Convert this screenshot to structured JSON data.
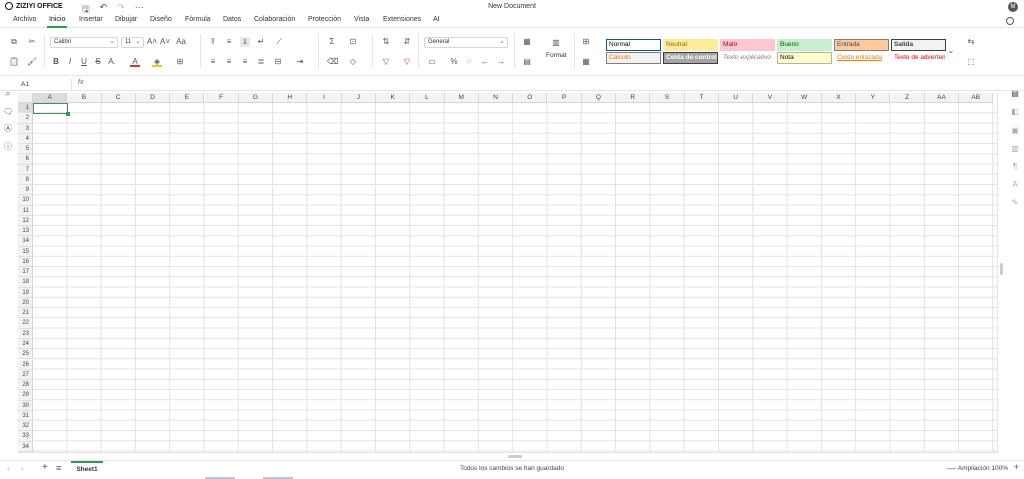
{
  "app": {
    "brand": "ZIZIYI OFFICE",
    "document_title": "New Document",
    "user_initial": "M"
  },
  "menu": {
    "items": [
      "Archivo",
      "Inicio",
      "Insertar",
      "Dibujar",
      "Diseño",
      "Fórmula",
      "Datos",
      "Colaboración",
      "Protección",
      "Vista",
      "Extensiones",
      "AI"
    ],
    "active": "Inicio"
  },
  "ribbon": {
    "font_name": "Calibri",
    "font_size": "11",
    "number_format": "General",
    "format_label": "Format",
    "cell_styles": [
      {
        "label": "Normal",
        "bg": "#ffffff",
        "fg": "#000000",
        "border": "#1f4e79"
      },
      {
        "label": "Neutral",
        "bg": "#ffeb9c",
        "fg": "#9c6500",
        "border": "#ffeb9c"
      },
      {
        "label": "Malo",
        "bg": "#ffc7ce",
        "fg": "#9c0006",
        "border": "#ffc7ce"
      },
      {
        "label": "Bueno",
        "bg": "#c6efce",
        "fg": "#006100",
        "border": "#c6efce"
      },
      {
        "label": "Entrada",
        "bg": "#ffcc99",
        "fg": "#3f3f76",
        "border": "#7f7f7f"
      },
      {
        "label": "Salida",
        "bg": "#f2f2f2",
        "fg": "#3f3f3f",
        "border": "#3f3f3f"
      },
      {
        "label": "Cálculo",
        "bg": "#f2f2f2",
        "fg": "#fa7d00",
        "border": "#7f7f7f"
      },
      {
        "label": "Celda de control",
        "bg": "#a5a5a5",
        "fg": "#ffffff",
        "border": "#3f3f3f"
      },
      {
        "label": "Texto explicativo",
        "bg": "#ffffff",
        "fg": "#7f7f7f",
        "border": "#ffffff"
      },
      {
        "label": "Nota",
        "bg": "#ffffcc",
        "fg": "#000000",
        "border": "#b2b2b2"
      },
      {
        "label": "Celda enlazada",
        "bg": "#ffffff",
        "fg": "#fa7d00",
        "border": "#ffffff"
      },
      {
        "label": "Texto de advertencia",
        "bg": "#ffffff",
        "fg": "#ff0000",
        "border": "#ffffff"
      }
    ]
  },
  "formula_bar": {
    "cell_ref": "A1",
    "fx_label": "fx",
    "value": ""
  },
  "sheet": {
    "columns": [
      "A",
      "B",
      "C",
      "D",
      "E",
      "F",
      "G",
      "H",
      "I",
      "J",
      "K",
      "L",
      "M",
      "N",
      "O",
      "P",
      "Q",
      "R",
      "S",
      "T",
      "U",
      "V",
      "W",
      "X",
      "Y",
      "Z",
      "AA",
      "AB"
    ],
    "rows": [
      "1",
      "2",
      "3",
      "4",
      "5",
      "6",
      "7",
      "8",
      "9",
      "10",
      "11",
      "12",
      "13",
      "14",
      "15",
      "16",
      "17",
      "18",
      "19",
      "20",
      "21",
      "22",
      "23",
      "24",
      "25",
      "26",
      "27",
      "28",
      "29",
      "30",
      "31",
      "32",
      "33",
      "34"
    ],
    "active_cell": "A1"
  },
  "footer": {
    "sheet_tab": "Sheet1",
    "save_status": "Todos los cambios se han guardado",
    "zoom_label": "Ampliación 100%"
  },
  "colors": {
    "accent": "#2e9a52",
    "header_bg": "#f3f3f3",
    "grid_line": "#e3e3e3"
  }
}
